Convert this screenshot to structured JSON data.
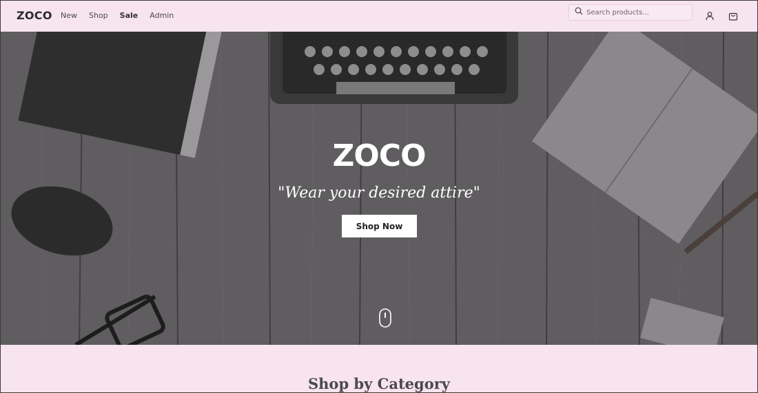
{
  "nav": {
    "brand": "ZOCO",
    "links": [
      "New",
      "Shop",
      "Sale",
      "Admin"
    ],
    "search_placeholder": "Search products...",
    "icons": [
      "search-icon",
      "user-icon",
      "shopping-bag-icon"
    ]
  },
  "hero": {
    "title": "ZOCO",
    "tagline": "\"Wear your desired attire\"",
    "cta_label": "Shop Now",
    "scroll_icon": "mouse-scroll-icon"
  },
  "category": {
    "title": "Shop by Category"
  },
  "colors": {
    "header_bg": "#f7e4ef",
    "hero_overlay": "#5e5c5e",
    "button_bg": "#ffffff",
    "text_dark": "#2b2b2b"
  }
}
